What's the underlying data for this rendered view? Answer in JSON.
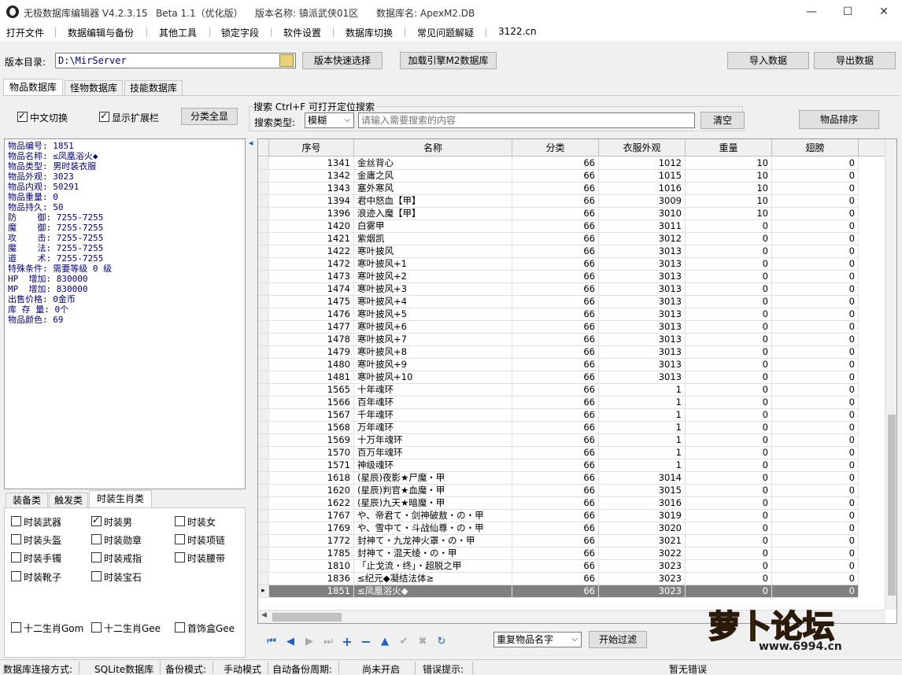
{
  "window": {
    "title": "无极数据库编辑器 V4.2.3.15",
    "beta": "Beta 1.1（优化版）",
    "version_name": "版本名称: 镇派武侠01区",
    "db_name": "数据库名: ApexM2.DB",
    "minimize": "—",
    "maximize": "☐",
    "close": "✕"
  },
  "menu": [
    "打开文件",
    "数据编辑与备份",
    "其他工具",
    "锁定字段",
    "软件设置",
    "数据库切换",
    "常见问题解疑",
    "3122.cn"
  ],
  "toolbar": {
    "dir_label": "版本目录:",
    "dir_value": "D:\\MirServer",
    "quick_select": "版本快速选择",
    "load_engine": "加载引擎M2数据库",
    "import": "导入数据",
    "export": "导出数据"
  },
  "tabs": [
    "物品数据库",
    "怪物数据库",
    "技能数据库"
  ],
  "options": {
    "chinese_switch": "中文切换",
    "show_ext": "显示扩展栏",
    "show_all": "分类全显",
    "search_title": "搜索  Ctrl+F 可打开定位搜索",
    "search_type_label": "搜索类型:",
    "search_type_value": "模糊",
    "search_placeholder": "请输入需要搜索的内容",
    "clear": "清空",
    "sort": "物品排序"
  },
  "item_info": [
    "物品编号: 1851",
    "物品名称: ≤凤凰浴火◆",
    "物品类型: 男时装衣服",
    "物品外观: 3023",
    "物品内观: 50291",
    "物品重量: 0",
    "物品持久: 50",
    "防    御: 7255-7255",
    "魔    御: 7255-7255",
    "攻    击: 7255-7255",
    "魔    法: 7255-7255",
    "道    术: 7255-7255",
    "特殊条件: 需要等级 0 级",
    "HP  增加: 830000",
    "MP  增加: 830000",
    "出售价格: 0金币",
    "库 存 量: 0个",
    "物品颜色: 69"
  ],
  "category_tabs": [
    "装备类",
    "触发类",
    "时装生肖类"
  ],
  "categories": [
    {
      "label": "时装武器",
      "checked": false
    },
    {
      "label": "时装男",
      "checked": true
    },
    {
      "label": "时装女",
      "checked": false
    },
    {
      "label": "时装头盔",
      "checked": false
    },
    {
      "label": "时装勋章",
      "checked": false
    },
    {
      "label": "时装项链",
      "checked": false
    },
    {
      "label": "时装手镯",
      "checked": false
    },
    {
      "label": "时装戒指",
      "checked": false
    },
    {
      "label": "时装腰带",
      "checked": false
    },
    {
      "label": "时装靴子",
      "checked": false
    },
    {
      "label": "时装宝石",
      "checked": false
    },
    {
      "label": "十二生肖Gom",
      "checked": false
    },
    {
      "label": "十二生肖Gee",
      "checked": false
    },
    {
      "label": "首饰盒Gee",
      "checked": false
    }
  ],
  "grid": {
    "columns": [
      "序号",
      "名称",
      "分类",
      "衣服外观",
      "重量",
      "翅膀"
    ],
    "selected_index": 34,
    "rows": [
      [
        "1341",
        "金丝背心",
        "66",
        "1012",
        "10",
        "0"
      ],
      [
        "1342",
        "金庸之风",
        "66",
        "1015",
        "10",
        "0"
      ],
      [
        "1343",
        "塞外寒风",
        "66",
        "1016",
        "10",
        "0"
      ],
      [
        "1394",
        "君中怒血【甲】",
        "66",
        "3009",
        "10",
        "0"
      ],
      [
        "1396",
        "浪迹入魔【甲】",
        "66",
        "3010",
        "10",
        "0"
      ],
      [
        "1420",
        "白雾甲",
        "66",
        "3011",
        "0",
        "0"
      ],
      [
        "1421",
        "紫烟凯",
        "66",
        "3012",
        "0",
        "0"
      ],
      [
        "1422",
        "寒叶披风",
        "66",
        "3013",
        "0",
        "0"
      ],
      [
        "1472",
        "寒叶披风+1",
        "66",
        "3013",
        "0",
        "0"
      ],
      [
        "1473",
        "寒叶披风+2",
        "66",
        "3013",
        "0",
        "0"
      ],
      [
        "1474",
        "寒叶披风+3",
        "66",
        "3013",
        "0",
        "0"
      ],
      [
        "1475",
        "寒叶披风+4",
        "66",
        "3013",
        "0",
        "0"
      ],
      [
        "1476",
        "寒叶披风+5",
        "66",
        "3013",
        "0",
        "0"
      ],
      [
        "1477",
        "寒叶披风+6",
        "66",
        "3013",
        "0",
        "0"
      ],
      [
        "1478",
        "寒叶披风+7",
        "66",
        "3013",
        "0",
        "0"
      ],
      [
        "1479",
        "寒叶披风+8",
        "66",
        "3013",
        "0",
        "0"
      ],
      [
        "1480",
        "寒叶披风+9",
        "66",
        "3013",
        "0",
        "0"
      ],
      [
        "1481",
        "寒叶披风+10",
        "66",
        "3013",
        "0",
        "0"
      ],
      [
        "1565",
        "十年魂环",
        "66",
        "1",
        "0",
        "0"
      ],
      [
        "1566",
        "百年魂环",
        "66",
        "1",
        "0",
        "0"
      ],
      [
        "1567",
        "千年魂环",
        "66",
        "1",
        "0",
        "0"
      ],
      [
        "1568",
        "万年魂环",
        "66",
        "1",
        "0",
        "0"
      ],
      [
        "1569",
        "十万年魂环",
        "66",
        "1",
        "0",
        "0"
      ],
      [
        "1570",
        "百万年魂环",
        "66",
        "1",
        "0",
        "0"
      ],
      [
        "1571",
        "神级魂环",
        "66",
        "1",
        "0",
        "0"
      ],
      [
        "1618",
        "(星辰)夜影★尸魔・甲",
        "66",
        "3014",
        "0",
        "0"
      ],
      [
        "1620",
        "(星辰)判官★血魔・甲",
        "66",
        "3015",
        "0",
        "0"
      ],
      [
        "1622",
        "(星辰)九天★暗魔・甲",
        "66",
        "3016",
        "0",
        "0"
      ],
      [
        "1767",
        "や、帝君て・剑神破敖・の・甲",
        "66",
        "3019",
        "0",
        "0"
      ],
      [
        "1769",
        "や、雪中て・斗战仙尊・の・甲",
        "66",
        "3020",
        "0",
        "0"
      ],
      [
        "1772",
        "封神て・九龙神火罩・の・甲",
        "66",
        "3021",
        "0",
        "0"
      ],
      [
        "1785",
        "封神て・混天绫・の・甲",
        "66",
        "3022",
        "0",
        "0"
      ],
      [
        "1810",
        "「止戈流・终」・超脱之甲",
        "66",
        "3023",
        "0",
        "0"
      ],
      [
        "1836",
        "≤纪元◆凝结法体≥",
        "66",
        "3023",
        "0",
        "0"
      ],
      [
        "1851",
        "≤凤凰浴火◆",
        "66",
        "3023",
        "0",
        "0"
      ]
    ]
  },
  "bottom": {
    "dup_select": "重复物品名字",
    "filter": "开始过滤"
  },
  "status": {
    "conn_label": "数据库连接方式:",
    "conn_value": "SQLite数据库",
    "backup_label": "备份模式:",
    "backup_value": "手动模式",
    "auto_label": "自动备份周期:",
    "auto_value": "尚未开启",
    "error_label": "错误提示:",
    "error_value": "暂无错误"
  },
  "watermark": "萝卜论坛 www.6994.cn",
  "colors": {
    "accent": "#000080",
    "selected_row": "#808080",
    "nav_icon": "#1f5fbf"
  }
}
